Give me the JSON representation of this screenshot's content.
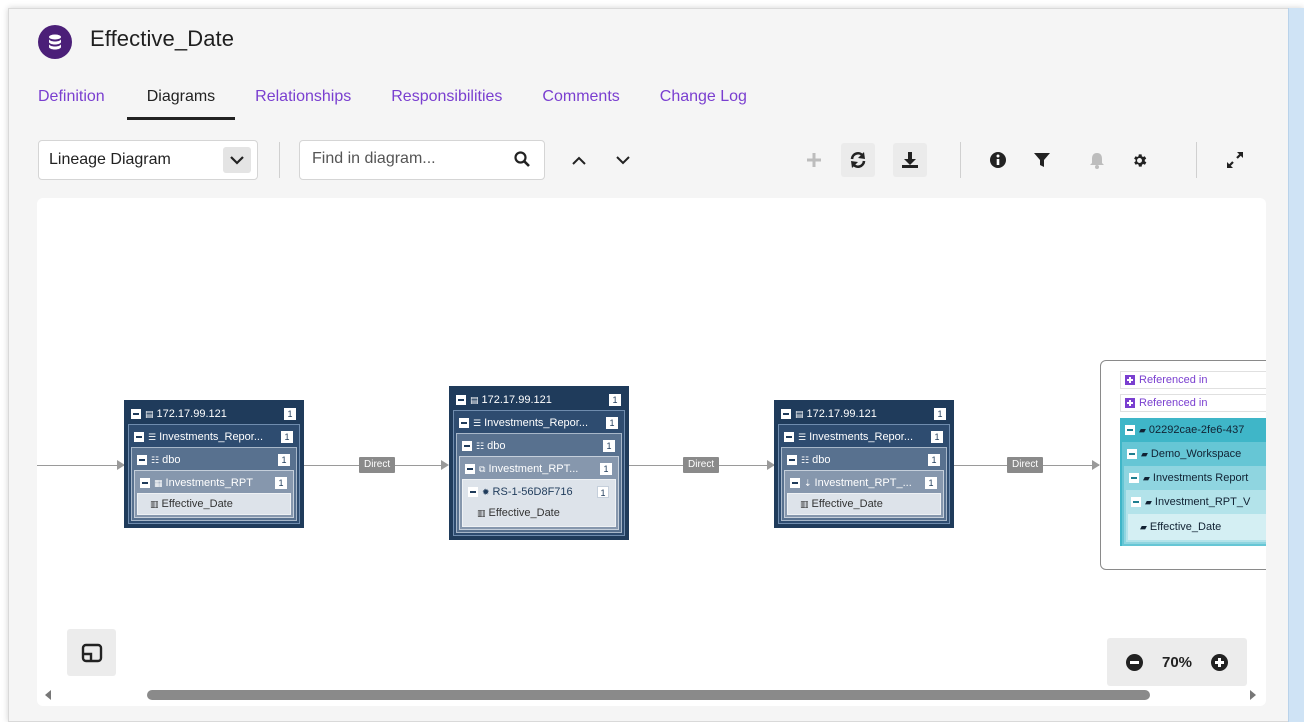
{
  "title": "Effective_Date",
  "tabs": [
    "Definition",
    "Diagrams",
    "Relationships",
    "Responsibilities",
    "Comments",
    "Change Log"
  ],
  "active_tab": "Diagrams",
  "toolbar": {
    "diagram_type": "Lineage Diagram",
    "search_placeholder": "Find in diagram..."
  },
  "edge_label": "Direct",
  "nodes": [
    {
      "server": "172.17.99.121",
      "server_count": "1",
      "db": "Investments_Repor...",
      "db_count": "1",
      "schema": "dbo",
      "schema_count": "1",
      "object": "Investments_RPT",
      "object_count": "1",
      "column": "Effective_Date"
    },
    {
      "server": "172.17.99.121",
      "server_count": "1",
      "db": "Investments_Repor...",
      "db_count": "1",
      "schema": "dbo",
      "schema_count": "1",
      "object": "Investment_RPT...",
      "object_count": "1",
      "sub": "RS-1-56D8F716",
      "sub_count": "1",
      "column": "Effective_Date"
    },
    {
      "server": "172.17.99.121",
      "server_count": "1",
      "db": "Investments_Repor...",
      "db_count": "1",
      "schema": "dbo",
      "schema_count": "1",
      "object": "Investment_RPT_...",
      "object_count": "1",
      "column": "Effective_Date"
    }
  ],
  "group": {
    "ref1": "Referenced in",
    "ref2": "Referenced in",
    "workspace_id": "02292cae-2fe6-437",
    "workspace": "Demo_Workspace",
    "report": "Investments Report",
    "dataset": "Investment_RPT_V",
    "column": "Effective_Date"
  },
  "zoom": "70%"
}
